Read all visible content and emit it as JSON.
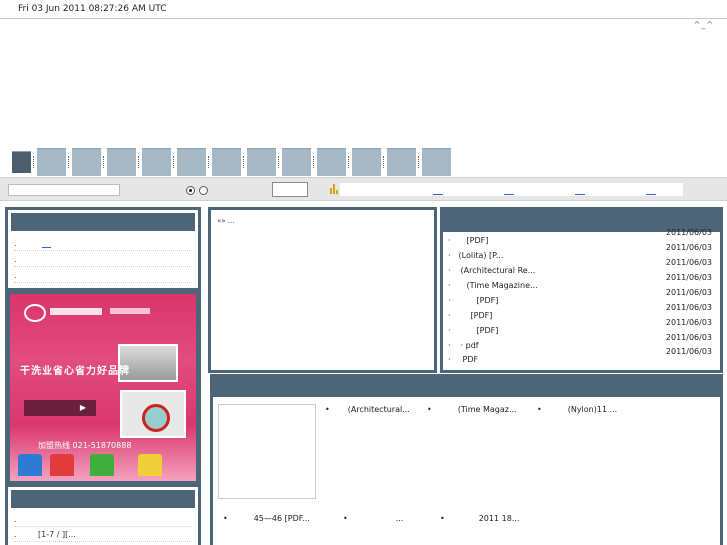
{
  "header": {
    "date": "Fri 03 Jun 2011 08:27:26 AM UTC",
    "smiley": "^_^"
  },
  "nav": {
    "tab_count": 13
  },
  "search": {
    "input_value": "",
    "button_label": ""
  },
  "left_top": {
    "items": [
      ".",
      ".",
      "."
    ]
  },
  "ad": {
    "slogan": "干洗业省心省力好品牌",
    "phone": "加盟热线 021-51870888"
  },
  "left_bottom": {
    "items": [
      ".",
      "[1-7 / ][..."
    ]
  },
  "mid_top": {
    "text": "«» ..."
  },
  "right_top": {
    "items": [
      {
        "title": "[PDF]",
        "date": "2011/06/03"
      },
      {
        "title": "(Lolita)      [P...",
        "date": "2011/06/03"
      },
      {
        "title": "(Architectural Re...",
        "date": "2011/06/03"
      },
      {
        "title": "(Time Magazine...",
        "date": "2011/06/03"
      },
      {
        "title": "[PDF]",
        "date": "2011/06/03"
      },
      {
        "title": "[PDF]",
        "date": "2011/06/03"
      },
      {
        "title": "[PDF]",
        "date": "2011/06/03"
      },
      {
        "title": "·   pdf",
        "date": "2011/06/03"
      },
      {
        "title": "PDF",
        "date": "2011/06/03"
      },
      {
        "title": "PDF",
        "date": ""
      }
    ]
  },
  "bottom": {
    "row1": [
      "(Architectural...",
      "(Time Magaz...",
      "(Nylon)11  ..."
    ],
    "row2": [
      "45—46  [PDF...",
      "...",
      "2011  18..."
    ]
  },
  "colors": {
    "panel_header": "#4d6578",
    "nav_tab": "#a6b7c5",
    "link": "#3366cc",
    "ad_pink": "#d9356b"
  }
}
